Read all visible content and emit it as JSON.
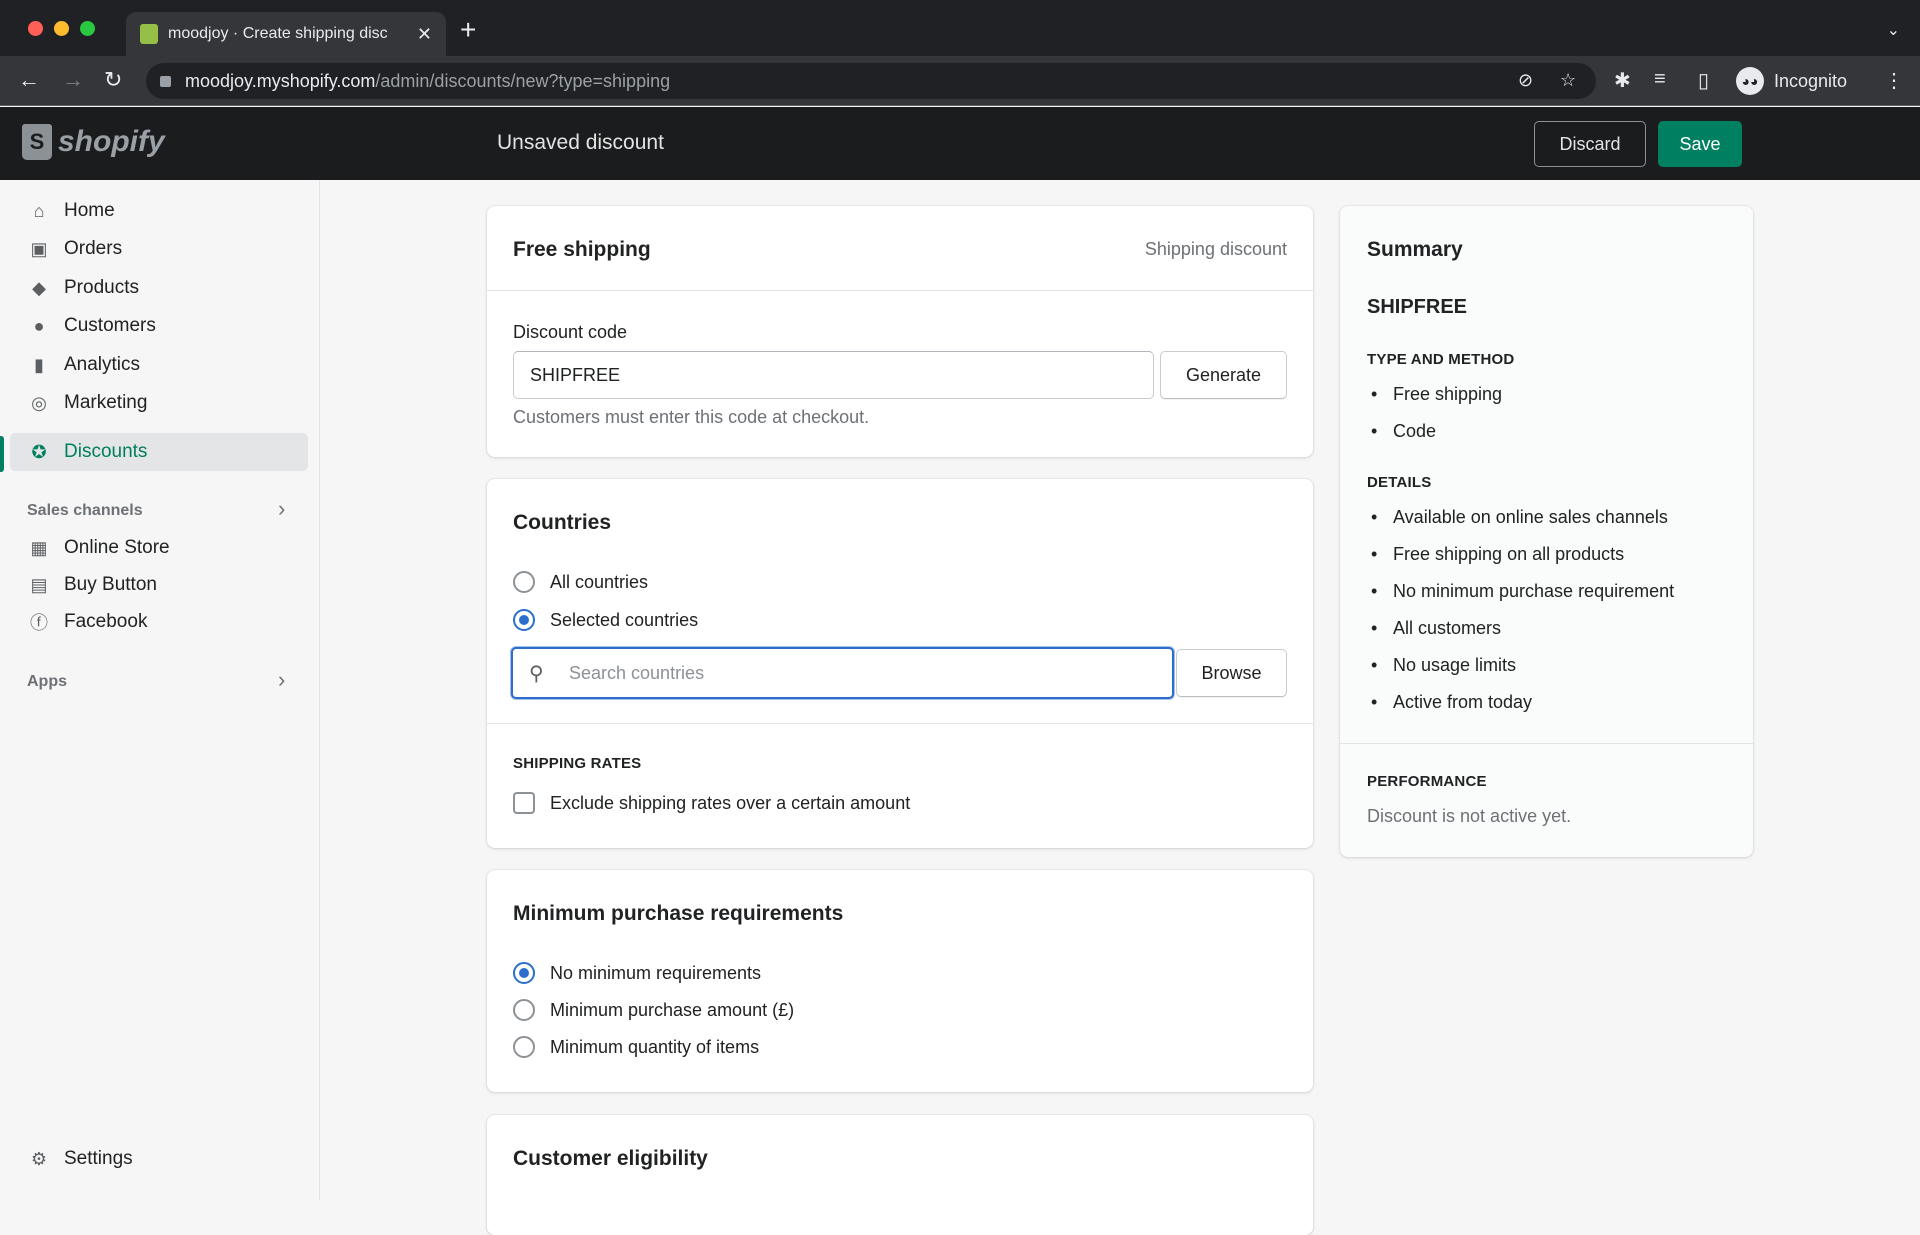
{
  "browser": {
    "tab_title": "moodjoy · Create shipping disc",
    "url_host": "moodjoy.myshopify.com",
    "url_path": "/admin/discounts/new?type=shipping",
    "profile_label": "Incognito"
  },
  "topbar": {
    "logo_text": "shopify",
    "page_title": "Unsaved discount",
    "discard_label": "Discard",
    "save_label": "Save"
  },
  "sidebar": {
    "items": [
      {
        "label": "Home",
        "icon": "home-icon"
      },
      {
        "label": "Orders",
        "icon": "orders-icon"
      },
      {
        "label": "Products",
        "icon": "tag-icon"
      },
      {
        "label": "Customers",
        "icon": "person-icon"
      },
      {
        "label": "Analytics",
        "icon": "bar-chart-icon"
      },
      {
        "label": "Marketing",
        "icon": "target-icon"
      },
      {
        "label": "Discounts",
        "icon": "discount-icon",
        "active": true
      }
    ],
    "sales_channels_label": "Sales channels",
    "channels": [
      {
        "label": "Online Store",
        "icon": "store-icon"
      },
      {
        "label": "Buy Button",
        "icon": "buy-button-icon"
      },
      {
        "label": "Facebook",
        "icon": "facebook-icon"
      }
    ],
    "apps_label": "Apps",
    "settings_label": "Settings"
  },
  "discount_card": {
    "title": "Free shipping",
    "type_label": "Shipping discount",
    "code_label": "Discount code",
    "code_value": "SHIPFREE",
    "generate_label": "Generate",
    "help_text": "Customers must enter this code at checkout."
  },
  "countries_card": {
    "title": "Countries",
    "options": [
      {
        "label": "All countries",
        "selected": false
      },
      {
        "label": "Selected countries",
        "selected": true
      }
    ],
    "search_placeholder": "Search countries",
    "browse_label": "Browse",
    "shipping_rates_heading": "SHIPPING RATES",
    "exclude_label": "Exclude shipping rates over a certain amount",
    "exclude_checked": false
  },
  "min_purchase_card": {
    "title": "Minimum purchase requirements",
    "options": [
      {
        "label": "No minimum requirements",
        "selected": true
      },
      {
        "label": "Minimum purchase amount (£)",
        "selected": false
      },
      {
        "label": "Minimum quantity of items",
        "selected": false
      }
    ]
  },
  "eligibility_card": {
    "title": "Customer eligibility"
  },
  "summary": {
    "title": "Summary",
    "code": "SHIPFREE",
    "type_heading": "TYPE AND METHOD",
    "type_items": [
      "Free shipping",
      "Code"
    ],
    "details_heading": "DETAILS",
    "details_items": [
      "Available on online sales channels",
      "Free shipping on all products",
      "No minimum purchase requirement",
      "All customers",
      "No usage limits",
      "Active from today"
    ],
    "performance_heading": "PERFORMANCE",
    "performance_text": "Discount is not active yet."
  },
  "colors": {
    "accent_green": "#008060",
    "focus_blue": "#2c6ecb"
  }
}
